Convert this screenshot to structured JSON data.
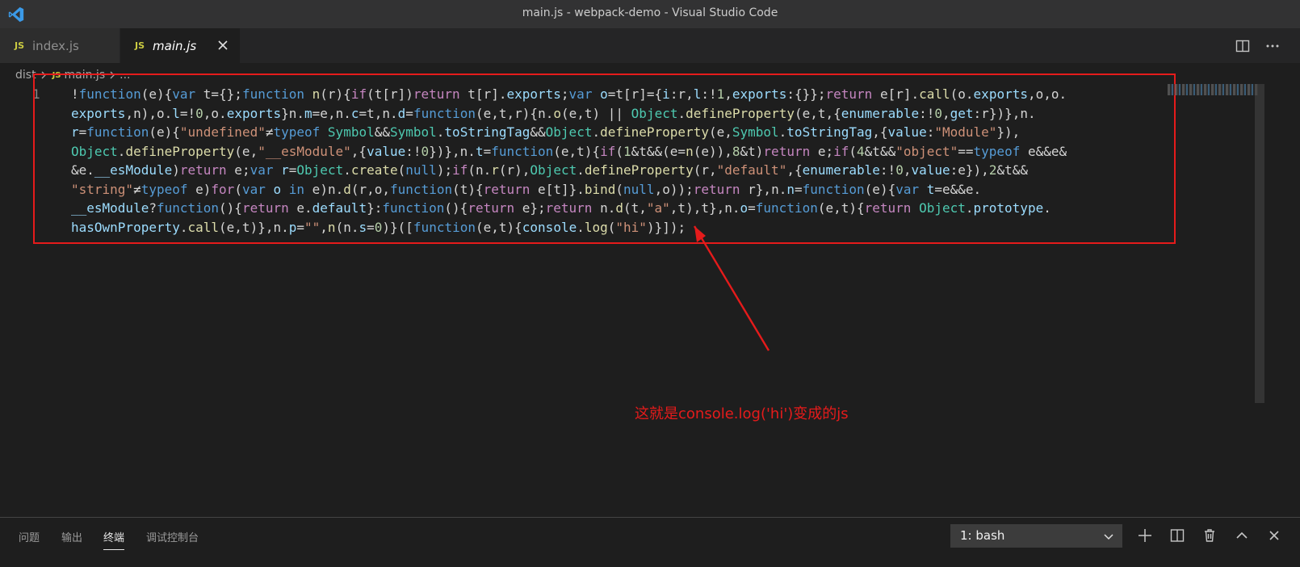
{
  "window": {
    "title": "main.js - webpack-demo - Visual Studio Code"
  },
  "colors": {
    "accent_red": "#e51b1b",
    "js_badge": "#cbcb41",
    "vscode_blue": "#3b9ae8"
  },
  "tabs": [
    {
      "badge": "JS",
      "label": "index.js"
    },
    {
      "badge": "JS",
      "label": "main.js"
    }
  ],
  "breadcrumb": {
    "folder": "dist",
    "badge": "JS",
    "file": "main.js",
    "more": "..."
  },
  "editor": {
    "line_number": "1"
  },
  "annotation": "这就是console.log('hi')变成的js",
  "panel": {
    "tabs": [
      "问题",
      "输出",
      "终端",
      "调试控制台"
    ],
    "terminal_select": "1: bash"
  },
  "icons": [
    "vscode-logo-icon",
    "close-icon",
    "split-editor-icon",
    "more-actions-icon",
    "chevron-right-icon",
    "plus-icon",
    "split-terminal-icon",
    "trash-icon",
    "chevron-up-icon",
    "close-panel-icon",
    "chevron-down-icon"
  ]
}
